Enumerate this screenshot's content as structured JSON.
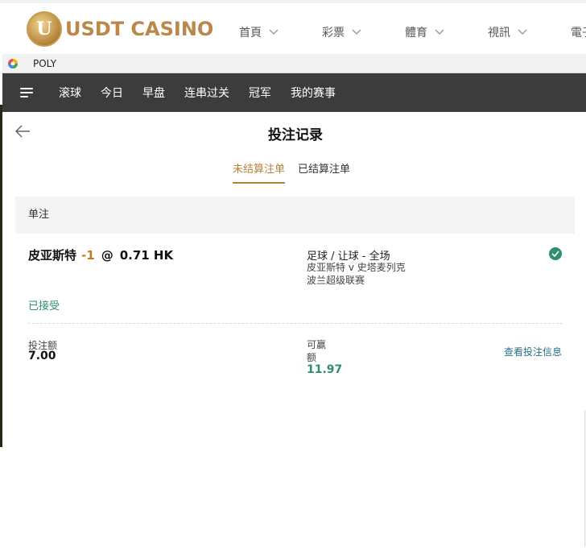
{
  "site": {
    "brand_text": "USDT CASINO",
    "brand_letter": "U",
    "nav": [
      {
        "label": "首頁"
      },
      {
        "label": "彩票"
      },
      {
        "label": "體育"
      },
      {
        "label": "視訊"
      },
      {
        "label": "電子"
      }
    ],
    "accent_color": "#b9884a"
  },
  "window": {
    "title": "POLY"
  },
  "sports_nav": {
    "menu_icon": "hamburger-menu-icon",
    "tabs": [
      {
        "label": "滚球"
      },
      {
        "label": "今日"
      },
      {
        "label": "早盘"
      },
      {
        "label": "连串过关"
      },
      {
        "label": "冠军"
      },
      {
        "label": "我的赛事"
      }
    ]
  },
  "page": {
    "title": "投注记录",
    "back_icon": "back-arrow-icon",
    "tabs": [
      {
        "label": "未结算注单",
        "active": true
      },
      {
        "label": "已结算注单",
        "active": false
      }
    ]
  },
  "section": {
    "title": "单注"
  },
  "bet": {
    "selection": "皮亚斯特",
    "handicap": "-1",
    "at": "@",
    "odds": "0.71 HK",
    "market": "足球 / 让球 - 全场",
    "match": "皮亚斯特 v 史塔麦列克",
    "league": "波兰超级联赛",
    "status": "已接受",
    "status_icon": "check-circle-icon",
    "stake_label": "投注额",
    "stake_value": "7.00",
    "win_label": "可赢额",
    "win_value": "11.97",
    "detail_link": "查看投注信息",
    "status_color": "#2f8f6f"
  }
}
